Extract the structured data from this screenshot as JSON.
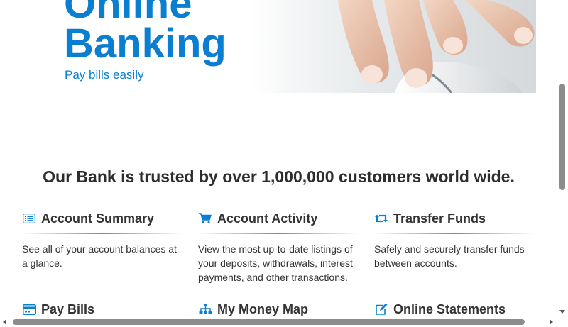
{
  "hero": {
    "title_line1": "Online",
    "title_line2": "Banking",
    "subtitle": "Pay bills easily",
    "image": "hand-on-mouse-photo"
  },
  "tagline": "Our Bank is trusted by over 1,000,000 customers world wide.",
  "features": [
    {
      "icon": "list-card-icon",
      "title": "Account Summary",
      "description": "See all of your account balances at a glance."
    },
    {
      "icon": "cart-icon",
      "title": "Account Activity",
      "description": "View the most up-to-date listings of your deposits, withdrawals, interest payments, and other transactions."
    },
    {
      "icon": "retweet-icon",
      "title": "Transfer Funds",
      "description": "Safely and securely transfer funds between accounts."
    },
    {
      "icon": "credit-card-icon",
      "title": "Pay Bills",
      "description": ""
    },
    {
      "icon": "sitemap-icon",
      "title": "My Money Map",
      "description": ""
    },
    {
      "icon": "edit-icon",
      "title": "Online Statements",
      "description": ""
    }
  ],
  "colors": {
    "accent": "#0a7fd1",
    "heading": "#2d2d2d",
    "text": "#333333"
  }
}
